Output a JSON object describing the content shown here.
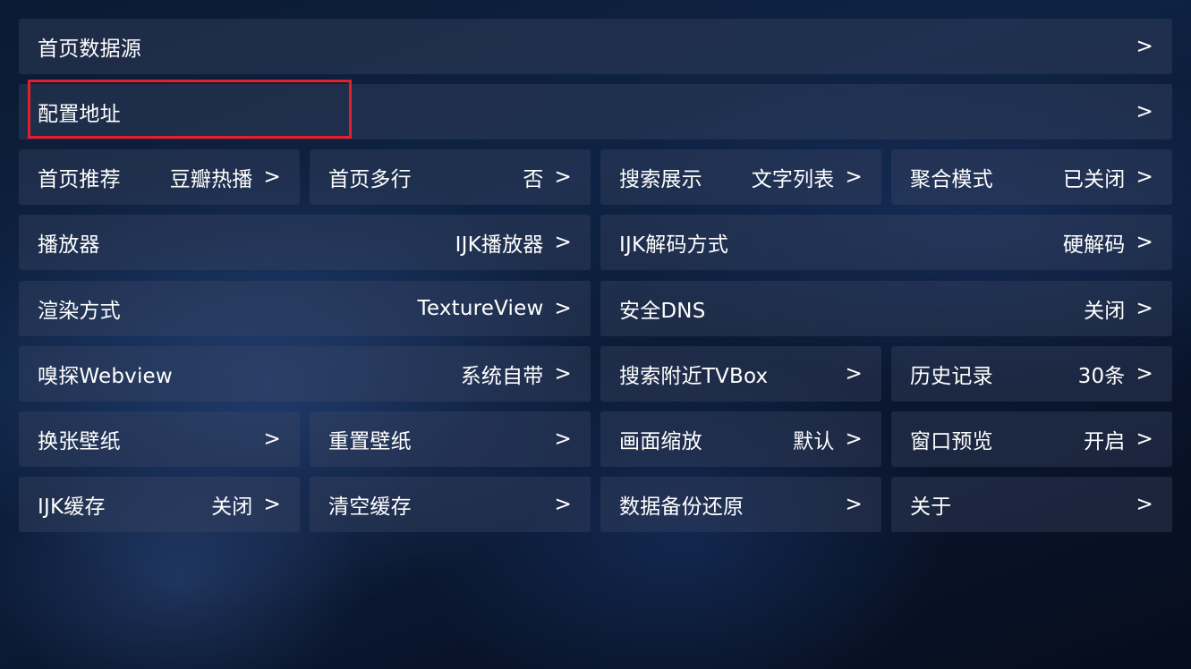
{
  "settings": {
    "home_source": {
      "label": "首页数据源",
      "chevron": ">"
    },
    "config_address": {
      "label": "配置地址",
      "chevron": ">"
    },
    "home_recommend": {
      "label": "首页推荐",
      "value": "豆瓣热播",
      "chevron": ">"
    },
    "home_multirow": {
      "label": "首页多行",
      "value": "否",
      "chevron": ">"
    },
    "search_display": {
      "label": "搜索展示",
      "value": "文字列表",
      "chevron": ">"
    },
    "aggregate_mode": {
      "label": "聚合模式",
      "value": "已关闭",
      "chevron": ">"
    },
    "player": {
      "label": "播放器",
      "value": "IJK播放器",
      "chevron": ">"
    },
    "ijk_decode": {
      "label": "IJK解码方式",
      "value": "硬解码",
      "chevron": ">"
    },
    "render_mode": {
      "label": "渲染方式",
      "value": "TextureView",
      "chevron": ">"
    },
    "secure_dns": {
      "label": "安全DNS",
      "value": "关闭",
      "chevron": ">"
    },
    "sniff_webview": {
      "label": "嗅探Webview",
      "value": "系统自带",
      "chevron": ">"
    },
    "search_nearby": {
      "label": "搜索附近TVBox",
      "chevron": ">"
    },
    "history": {
      "label": "历史记录",
      "value": "30条",
      "chevron": ">"
    },
    "change_wallpaper": {
      "label": "换张壁纸",
      "chevron": ">"
    },
    "reset_wallpaper": {
      "label": "重置壁纸",
      "chevron": ">"
    },
    "screen_scale": {
      "label": "画面缩放",
      "value": "默认",
      "chevron": ">"
    },
    "window_preview": {
      "label": "窗口预览",
      "value": "开启",
      "chevron": ">"
    },
    "ijk_cache": {
      "label": "IJK缓存",
      "value": "关闭",
      "chevron": ">"
    },
    "clear_cache": {
      "label": "清空缓存",
      "chevron": ">"
    },
    "backup_restore": {
      "label": "数据备份还原",
      "chevron": ">"
    },
    "about": {
      "label": "关于",
      "chevron": ">"
    }
  },
  "colors": {
    "focus_border": "#e0202a"
  }
}
